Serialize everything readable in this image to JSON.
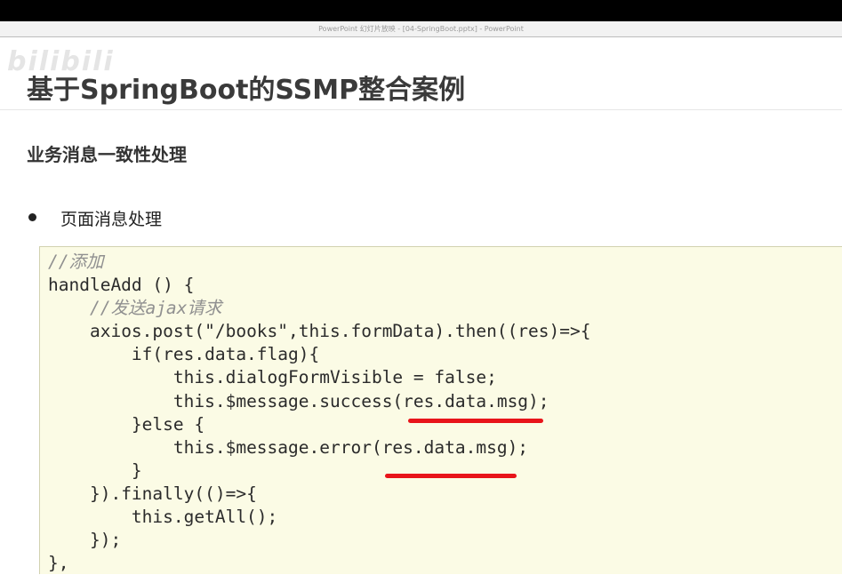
{
  "window": {
    "title": "PowerPoint 幻灯片放映 - [04-SpringBoot.pptx] - PowerPoint"
  },
  "watermark": {
    "text": "bilibili"
  },
  "slide": {
    "title": "基于SpringBoot的SSMP整合案例",
    "subtitle": "业务消息一致性处理",
    "bullet": "页面消息处理"
  },
  "code": {
    "lines": [
      "//添加",
      "handleAdd () {",
      "//发送ajax请求",
      "axios.post(\"/books\",this.formData).then((res)=>{",
      "if(res.data.flag){",
      "this.dialogFormVisible = false;",
      "this.$message.success(res.data.msg);",
      "}else {",
      "this.$message.error(res.data.msg);",
      "}",
      "}).finally(()=>{",
      "this.getAll();",
      "});",
      "},"
    ]
  },
  "colors": {
    "highlight_underline": "#e8141a",
    "code_background": "#fbfbe5"
  }
}
